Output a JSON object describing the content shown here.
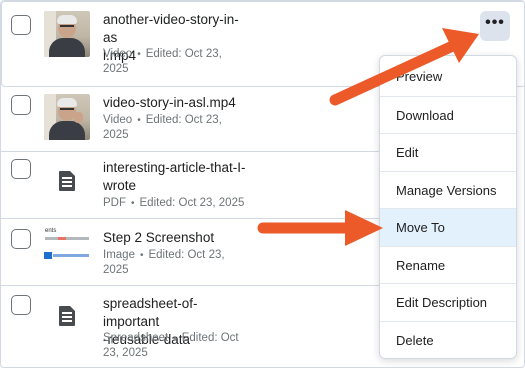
{
  "files": [
    {
      "name": "another-video-story-in-as\nl.mp4",
      "type": "Video",
      "edited": "Edited: Oct 23, 2025",
      "meta_line1": "Video",
      "meta_line2": "Edited: Oct 23,",
      "meta_line3": "2025",
      "thumb": "video-thumbnail"
    },
    {
      "name": "video-story-in-asl.mp4",
      "type": "Video",
      "meta_line1": "Video",
      "meta_line2": "Edited: Oct 23,",
      "meta_line3": "2025",
      "thumb": "video-thumbnail"
    },
    {
      "name_line1": "interesting-article-that-I-",
      "name_line2": "wrote",
      "meta_line1": "PDF",
      "meta_line2": "Edited: Oct 23, 2025",
      "thumb": "document-icon"
    },
    {
      "name": "Step 2 Screenshot",
      "meta_line1": "Image",
      "meta_line2": "Edited: Oct 23,",
      "meta_line3": "2025",
      "thumb": "image-thumbnail"
    },
    {
      "name_line1": "spreadsheet-of-important",
      "name_line2": "-reusable-data",
      "meta_line1": "Spreadsheet",
      "meta_line2": "Edited: Oct",
      "meta_line3": "23, 2025",
      "thumb": "document-icon"
    }
  ],
  "row1": {
    "name_line1": "another-video-story-in-as",
    "name_line2": "l.mp4",
    "meta_type": "Video",
    "meta_edit": "Edited: Oct 23,",
    "meta_year": "2025"
  },
  "row2": {
    "name_line1": "video-story-in-asl.mp4",
    "meta_type": "Video",
    "meta_edit": "Edited: Oct 23,",
    "meta_year": "2025"
  },
  "row3": {
    "name_line1": "interesting-article-that-I-",
    "name_line2": "wrote",
    "meta_type": "PDF",
    "meta_edit": "Edited: Oct 23, 2025"
  },
  "row4": {
    "name_line1": "Step 2 Screenshot",
    "meta_type": "Image",
    "meta_edit": "Edited: Oct 23,",
    "meta_year": "2025",
    "thumb_text": "ents"
  },
  "row5": {
    "name_line1": "spreadsheet-of-important",
    "name_line2": "-reusable-data",
    "meta_type": "Spreadsheet",
    "meta_edit": "Edited: Oct",
    "meta_year": "23, 2025"
  },
  "more_button": {
    "label": "•••"
  },
  "menu": {
    "items": [
      "Preview",
      "Download",
      "Edit",
      "Manage Versions",
      "Move To",
      "Rename",
      "Edit Description",
      "Delete"
    ],
    "active_item": "Move To"
  },
  "colors": {
    "arrow": "#ec5a2a",
    "menu_active_bg": "#e3f1fc",
    "more_button_bg": "#dde3ec"
  },
  "dot_separator": "•"
}
